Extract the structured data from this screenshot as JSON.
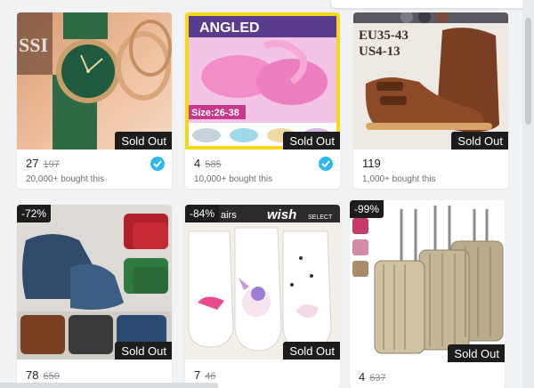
{
  "products": [
    {
      "price": "27",
      "old_price": "197",
      "bought": "20,000+ bought this",
      "status": "Sold Out",
      "verified": true,
      "image_text": "SSI"
    },
    {
      "price": "4",
      "old_price": "585",
      "bought": "10,000+ bought this",
      "status": "Sold Out",
      "verified": true,
      "image_text_top": "ANGLED",
      "image_text_size": "Size:26-38"
    },
    {
      "price": "119",
      "old_price": "",
      "bought": "1,000+ bought this",
      "status": "Sold Out",
      "verified": false,
      "image_text_1": "EU35-43",
      "image_text_2": "US4-13"
    },
    {
      "discount": "-72%",
      "price": "78",
      "old_price": "650",
      "status": "Sold Out"
    },
    {
      "discount": "-84%",
      "price": "7",
      "old_price": "46",
      "status": "Sold Out",
      "image_text_left": "airs",
      "image_text_logo": "wish",
      "image_text_select": "SELECT"
    },
    {
      "discount": "-99%",
      "price": "4",
      "old_price": "637",
      "status": "Sold Out"
    }
  ],
  "colors": {
    "badge_bg": "#1c1c1c",
    "verified_blue": "#2fb7ec",
    "page_bg": "#f1f3f5"
  }
}
